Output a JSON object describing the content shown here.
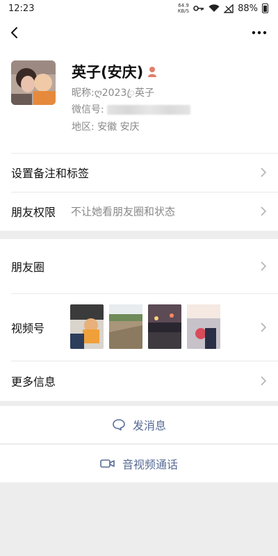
{
  "status_bar": {
    "time": "12:23",
    "net_speed_value": "64.9",
    "net_speed_unit": "KB/S",
    "battery": "88%"
  },
  "profile": {
    "name": "英子(安庆)",
    "nickname_label": "昵称:",
    "nickname_value": "ღ2023ꦿ英子",
    "wechat_id_label": "微信号:",
    "region_label": "地区:",
    "region_value": "安徽  安庆"
  },
  "menu": {
    "remark_tags": "设置备注和标签",
    "friend_permission": "朋友权限",
    "friend_permission_value": "不让她看朋友圈和状态",
    "moments": "朋友圈",
    "channels": "视频号",
    "more_info": "更多信息"
  },
  "actions": {
    "send_message": "发消息",
    "voice_video_call": "音视频通话"
  },
  "colors": {
    "link_blue": "#576b95",
    "gender_female": "#e07f6b",
    "background": "#ededed"
  }
}
